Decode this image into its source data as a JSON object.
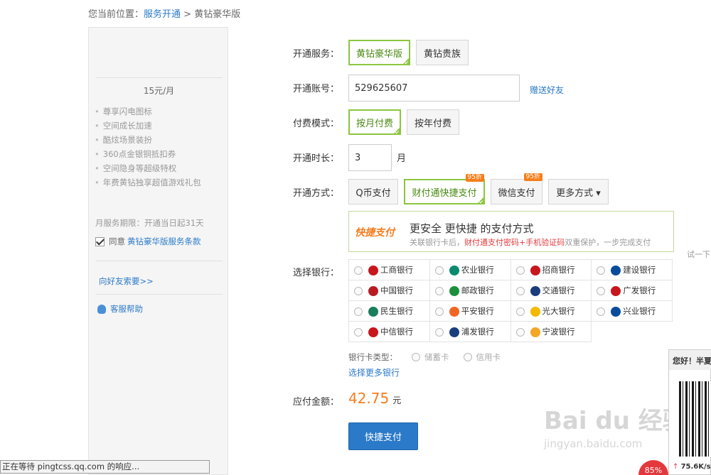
{
  "breadcrumb": {
    "prefix": "您当前位置：",
    "link": "服务开通",
    "sep": " > ",
    "current": "黄钻豪华版"
  },
  "sidebar": {
    "price": "15元/月",
    "features": [
      "尊享闪电图标",
      "空间成长加速",
      "酷炫场景装扮",
      "360点金银铜抵扣券",
      "空间隐身等超级特权",
      "年费黄钻独享超值游戏礼包"
    ],
    "period": "月服务期限：开通当日起31天",
    "agree_prefix": "同意",
    "agree_link": "黄钻豪华版服务条款",
    "gift_link": "向好友索要>>",
    "help_link": "客服帮助"
  },
  "form": {
    "service_label": "开通服务：",
    "service_options": [
      "黄钻豪华版",
      "黄钻贵族"
    ],
    "account_label": "开通账号：",
    "account_value": "529625607",
    "gift_friend": "赠送好友",
    "mode_label": "付费模式：",
    "mode_options": [
      "按月付费",
      "按年付费"
    ],
    "duration_label": "开通时长：",
    "duration_value": "3",
    "duration_unit": "月",
    "method_label": "开通方式：",
    "methods": [
      "Q币支付",
      "财付通快捷支付",
      "微信支付",
      "更多方式 ▾"
    ],
    "discount_tag": "95折",
    "bank_label": "选择银行：",
    "card_type_label": "银行卡类型：",
    "card_types": [
      "储蓄卡",
      "信用卡"
    ],
    "more_banks": "选择更多银行",
    "amount_label": "应付金额：",
    "amount": "42.75",
    "amount_unit": "元",
    "pay_button": "快捷支付"
  },
  "banner": {
    "logo": "快捷支付",
    "title": "更安全  更快捷 的支付方式",
    "desc_prefix": "关联银行卡后，",
    "desc_highlight": "财付通支付密码+手机验证码",
    "desc_suffix": "双重保护，一步完成支付",
    "try": "试一下"
  },
  "banks": [
    [
      "工商银行",
      "农业银行",
      "招商银行",
      "建设银行"
    ],
    [
      "中国银行",
      "邮政银行",
      "交通银行",
      "广发银行"
    ],
    [
      "民生银行",
      "平安银行",
      "光大银行",
      "兴业银行"
    ],
    [
      "中信银行",
      "浦发银行",
      "宁波银行"
    ]
  ],
  "chat": {
    "greeting": "您好！半夏"
  },
  "speed": {
    "value": "75.6K/s",
    "percent": "85%"
  },
  "status_bar": "正在等待 pingtcss.qq.com 的响应...",
  "watermark": {
    "brand": "Bai du 经验",
    "url": "jingyan.baidu.com"
  },
  "colors": {
    "accent": "#2b7ac9",
    "selected": "#8cc540",
    "price": "#f47d20"
  }
}
